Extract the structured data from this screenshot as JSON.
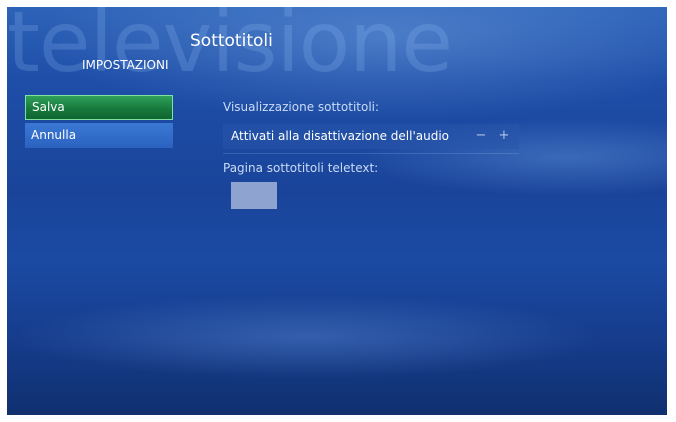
{
  "background": {
    "watermark_text": "televisione"
  },
  "header": {
    "title": "Sottotitoli",
    "section": "IMPOSTAZIONI"
  },
  "sidebar": {
    "buttons": [
      {
        "label": "Salva",
        "state": "selected"
      },
      {
        "label": "Annulla",
        "state": "normal"
      }
    ]
  },
  "settings": {
    "subtitles_display": {
      "label": "Visualizzazione sottotitoli:",
      "value": "Attivati alla disattivazione dell'audio",
      "decrease_label": "−",
      "increase_label": "+"
    },
    "teletext_page": {
      "label": "Pagina sottotitoli teletext:",
      "value": ""
    }
  },
  "colors": {
    "background_blue": "#1e4ea8",
    "selected_green": "#187a3e",
    "button_blue": "#2b62c0"
  }
}
